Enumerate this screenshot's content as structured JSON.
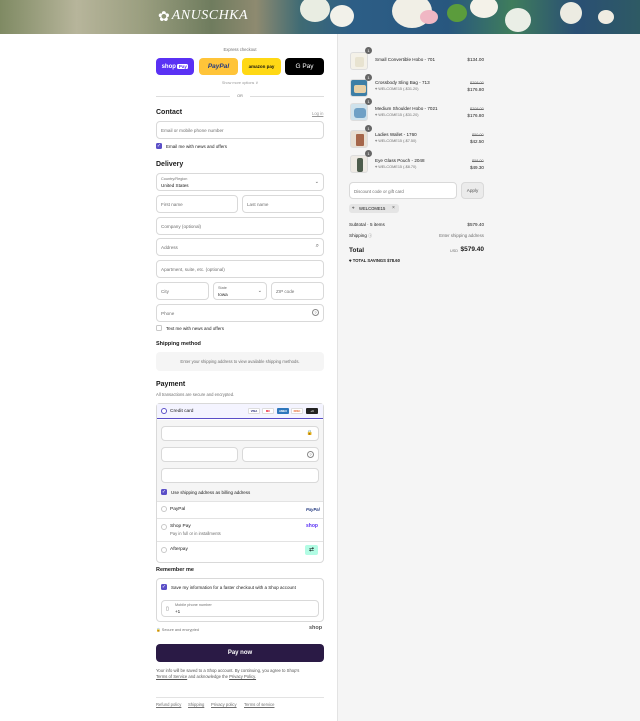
{
  "brand": {
    "logo_text": "ANUSCHKA"
  },
  "express": {
    "title": "Express checkout",
    "shop_pay": "shop",
    "shop_pay_badge": "Pay",
    "paypal": "PayPal",
    "amazon_pay": "amazon pay",
    "gpay": "G Pay",
    "more": "Show more options ∨",
    "or": "OR"
  },
  "contact": {
    "title": "Contact",
    "login": "Log in",
    "email_placeholder": "Email or mobile phone number",
    "news_label": "Email me with news and offers"
  },
  "delivery": {
    "title": "Delivery",
    "country_label": "Country/Region",
    "country_value": "United States",
    "first_name": "First name",
    "last_name": "Last name",
    "company": "Company (optional)",
    "address": "Address",
    "apartment": "Apartment, suite, etc. (optional)",
    "city": "City",
    "state_label": "State",
    "state_value": "Iowa",
    "zip": "ZIP code",
    "phone": "Phone",
    "text_label": "Text me with news and offers"
  },
  "shipping": {
    "title": "Shipping method",
    "message": "Enter your shipping address to view available shipping methods."
  },
  "payment": {
    "title": "Payment",
    "subtitle": "All transactions are secure and encrypted.",
    "credit_card": "Credit card",
    "card_brands": [
      "VISA",
      "MC",
      "AMEX",
      "DISC",
      "+4"
    ],
    "billing_label": "Use shipping address as billing address",
    "paypal": "PayPal",
    "paypal_logo": "PayPal",
    "shop_pay": "Shop Pay",
    "shop_pay_sub": "Pay in full or in installments",
    "shop_logo": "shop",
    "afterpay": "Afterpay"
  },
  "remember": {
    "title": "Remember me",
    "save_label": "Save my information for a faster checkout with a Shop account",
    "mobile_label": "Mobile phone number",
    "mobile_prefix": "+1",
    "secure": "Secure and encrypted",
    "shop_logo": "shop"
  },
  "pay_button": "Pay now",
  "terms": {
    "line1": "Your info will be saved to a Shop account. By continuing, you agree to Shop's",
    "terms_link": "Terms of Service",
    "and": "and acknowledge the",
    "privacy_link": "Privacy Policy."
  },
  "footer": {
    "links": [
      "Refund policy",
      "Shipping",
      "Privacy policy",
      "Terms of service"
    ]
  },
  "cart": {
    "items": [
      {
        "qty": "1",
        "name": "Small Convertible Hobo - 701",
        "discount": "",
        "original": "",
        "price": "$134.00"
      },
      {
        "qty": "1",
        "name": "Crossbody Sling Bag - 713",
        "discount": "WELCOME15 (-$31.20)",
        "original": "$208.00",
        "price": "$176.80"
      },
      {
        "qty": "1",
        "name": "Medium Shoulder Hobo - 7021",
        "discount": "WELCOME15 (-$31.20)",
        "original": "$208.00",
        "price": "$176.80"
      },
      {
        "qty": "1",
        "name": "Ladies Wallet - 1760",
        "discount": "WELCOME15 (-$7.50)",
        "original": "$50.00",
        "price": "$42.50"
      },
      {
        "qty": "1",
        "name": "Eye Glass Pouch - 2048",
        "discount": "WELCOME15 (-$8.70)",
        "original": "$58.00",
        "price": "$49.30"
      }
    ],
    "discount_placeholder": "Discount code or gift card",
    "apply": "Apply",
    "applied_code": "WELCOME15",
    "subtotal_label": "Subtotal · 5 items",
    "subtotal_value": "$579.40",
    "shipping_label": "Shipping",
    "shipping_value": "Enter shipping address",
    "total_label": "Total",
    "currency": "USD",
    "total_value": "$579.40",
    "savings_label": "TOTAL SAVINGS",
    "savings_value": "$78.60"
  }
}
